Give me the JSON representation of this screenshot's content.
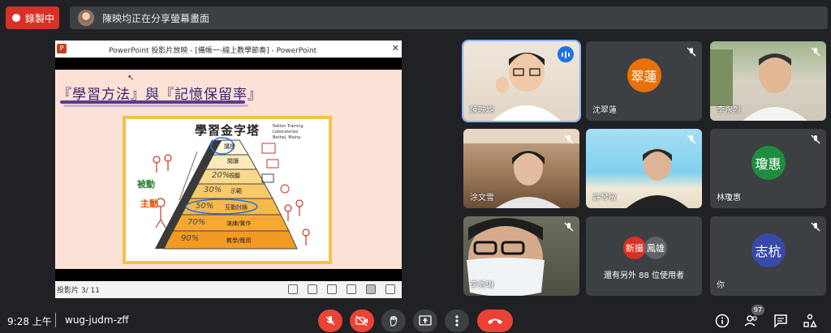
{
  "recording": {
    "label": "錄製中"
  },
  "share_banner": {
    "text": "陳映均正在分享螢幕畫面"
  },
  "presentation": {
    "window_title": "PowerPoint 投影片放映 - [備帳一-線上教學節奏] - PowerPoint",
    "slide_heading": "『學習方法』與『記憶保留率』",
    "pyramid_title": "學習金字塔",
    "org_lines": [
      "Nation Training Laboratories",
      "Bethel, Maine"
    ],
    "levels": [
      "講授",
      "閱讀",
      "視聽",
      "示範",
      "互動討論",
      "演練/實作",
      "教學/應用"
    ],
    "percents": [
      "20%",
      "30%",
      "50%",
      "70%",
      "90%"
    ],
    "side_passive": "被動",
    "side_active": "主動",
    "status_text": "投影片 3/ 11"
  },
  "participants": [
    {
      "name": "陳映均",
      "type": "video",
      "speaking": true
    },
    {
      "name": "沈翠蓮",
      "initials": "翠蓮",
      "color": "#e8710a",
      "type": "avatar"
    },
    {
      "name": "李永烈",
      "type": "video"
    },
    {
      "name": "涂文雪",
      "type": "video"
    },
    {
      "name": "許琴敏",
      "type": "video"
    },
    {
      "name": "林瓊惠",
      "initials": "瓊惠",
      "color": "#1e8e3e",
      "type": "avatar"
    },
    {
      "name": "李秀琳",
      "type": "video"
    },
    {
      "name": "more",
      "type": "more",
      "more_text": "還有另外 88 位使用者",
      "mini": [
        {
          "initials": "新撮",
          "color": "#d93025"
        },
        {
          "initials": "鳳雄",
          "color": "#5f6368"
        }
      ]
    },
    {
      "name": "你",
      "initials": "志杭",
      "color": "#3949ab",
      "type": "avatar"
    }
  ],
  "bottom_bar": {
    "time": "9:28 上午",
    "meeting_code": "wug-judm-zff",
    "people_count": "97"
  }
}
